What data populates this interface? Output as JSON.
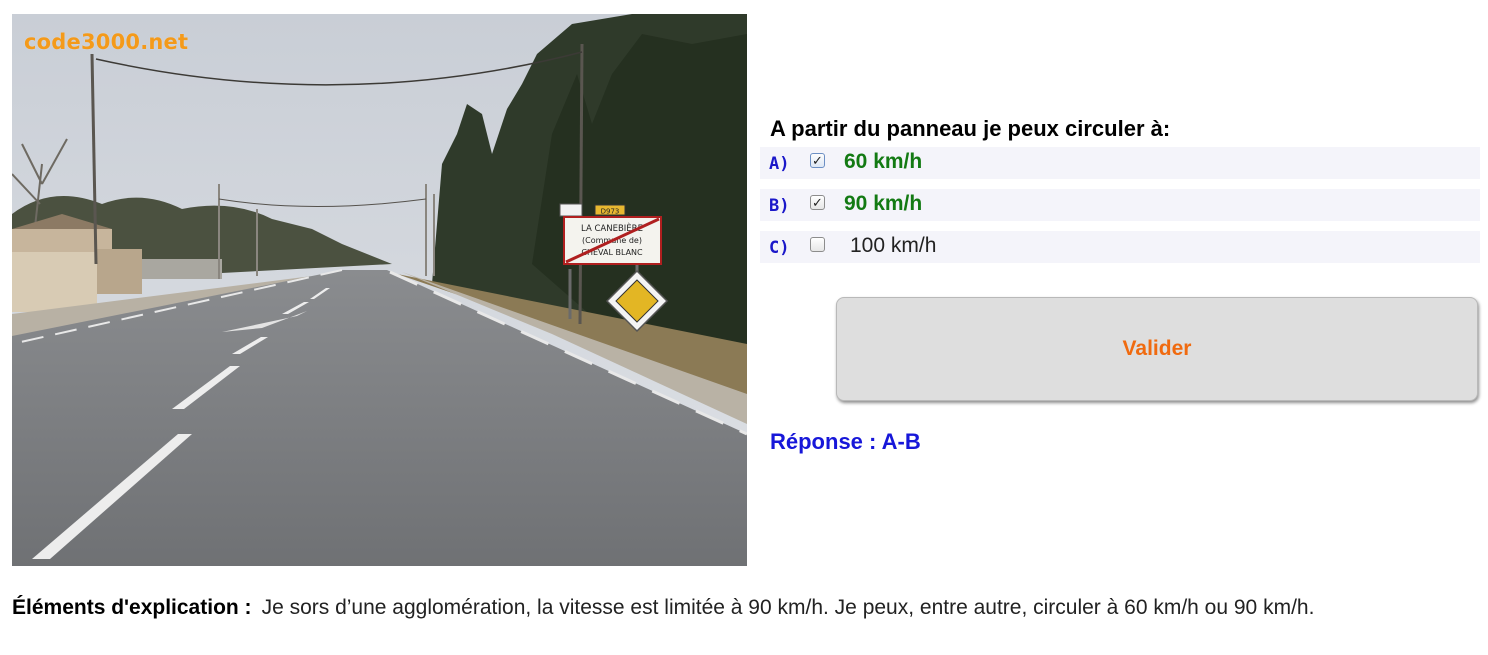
{
  "image": {
    "watermark": "code3000.net",
    "sign_line1": "LA CANEBIÈRE",
    "sign_line2": "(Commune de)",
    "sign_line3": "CHEVAL BLANC",
    "road_number": "D973"
  },
  "question": {
    "text": "A partir du panneau je peux circuler à:",
    "options": [
      {
        "letter": "A)",
        "label": "60 km/h",
        "checked": true
      },
      {
        "letter": "B)",
        "label": "90 km/h",
        "checked": true
      },
      {
        "letter": "C)",
        "label": "100 km/h",
        "checked": false
      }
    ]
  },
  "validate_label": "Valider",
  "answer": "Réponse : A-B",
  "explanation": {
    "label": "Éléments d'explication :",
    "text": "Je sors d’une agglomération, la vitesse est limitée à 90 km/h. Je peux, entre autre, circuler à 60 km/h ou 90 km/h."
  },
  "colors": {
    "watermark": "#f49a1a",
    "option_letter": "#1b18c9",
    "correct_option": "#137a13",
    "button_text": "#f06a0f",
    "answer": "#1717d9"
  }
}
